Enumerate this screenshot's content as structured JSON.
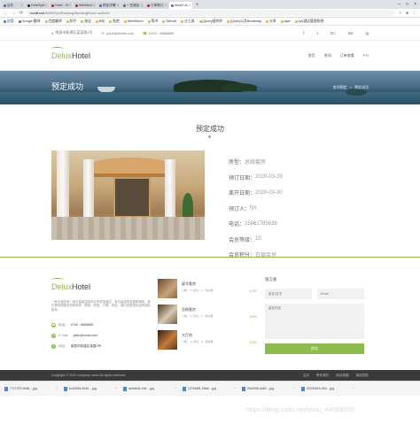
{
  "browser": {
    "tabs": [
      {
        "label": "这件"
      },
      {
        "label": "HotelSystem/s"
      },
      {
        "label": "Hotel - Gitee"
      },
      {
        "label": "WebMusicoptic"
      },
      {
        "label": "预定详情管理"
      },
      {
        "label": "一些酒店"
      },
      {
        "label": "订单预订系统"
      },
      {
        "label": "About Us"
      }
    ],
    "url_host": "localhost",
    "url_path": ":8080/Sys/Booking/BookingRoom.action#",
    "bookmarks": [
      "应用",
      "Google 翻译",
      "百度翻译",
      "知乎",
      "淘宝",
      "B站",
      "贴吧",
      "WebStorm",
      "简书",
      "GitHub",
      "计工具",
      "jQuery插件库",
      "jQuery以及Bootstrap",
      "分享",
      "ajax",
      "sys酒店管理系统"
    ]
  },
  "topbar": {
    "address": "南昌市新建区某某路1号",
    "email": "yuhe@email.com",
    "phone": "0769 - 8888888",
    "social": [
      "f",
      "t",
      "G+",
      "Be",
      "ig"
    ]
  },
  "header": {
    "logo_part1": "Delux",
    "logo_part2": "Hotel",
    "nav": [
      "首页",
      "房间",
      "订单查看",
      "FYI"
    ]
  },
  "banner": {
    "title": "预定成功",
    "crumb_home": "房间预定",
    "crumb_sep": ">",
    "crumb_current": "预定成功"
  },
  "booking": {
    "heading": "预定成功",
    "rows": [
      {
        "key": "房型：",
        "value": "总统套房"
      },
      {
        "key": "预订日期：",
        "value": "2020-03-29"
      },
      {
        "key": "离开日期：",
        "value": "2020-03-30"
      },
      {
        "key": "预订人：",
        "value": "fys"
      },
      {
        "key": "电话：",
        "value": "15861785638"
      },
      {
        "key": "会员等级：",
        "value": "10"
      },
      {
        "key": "会员积分：",
        "value": "白银会员"
      }
    ]
  },
  "footer": {
    "logo_part1": "Delux",
    "logo_part2": "Hotel",
    "description": "一家大酒店有一间五星级温泉设计的宾馆酒店，有五星级的设施和服务。我们提供的服务多种多样，周到、舒适、方便、安全。我们这里是欢迎有朋友前来。",
    "phone_label": "电话：",
    "phone": "0769 - 8888888",
    "email_label": "E-mail：",
    "email": "yifan@email.com",
    "address_label": "地址：",
    "address": "南昌市新建区某路2号",
    "rooms": [
      {
        "name": "豪华套房",
        "meta": "人数：4 | 床位：2 - 热水器",
        "price": "¥ 300"
      },
      {
        "name": "总统套房",
        "meta": "人数：4 | 床位：2 - 热水器",
        "price": "¥ 500"
      },
      {
        "name": "大厅房",
        "meta": "人数：4 | 床位：2 - 热水器",
        "price": "¥ 600"
      }
    ],
    "form_title": "留言板",
    "name_placeholder": "姓名/名字",
    "email_placeholder": "Email",
    "message_placeholder": "留言内容",
    "send_label": "提交"
  },
  "copyright": {
    "text": "Copyright © 2020 company name All rights reserved.",
    "links": [
      "主页",
      "联系我们",
      "网站地图",
      "网站导航"
    ]
  },
  "downloads": [
    {
      "name": "77c7379-40a6 ...jpg"
    },
    {
      "name": "bc2b53a-814e ...jpg"
    },
    {
      "name": "ae9a5d1-44e ...jpg"
    },
    {
      "name": "127bb8f1-28a6 ...jpg"
    },
    {
      "name": "26d3f36-4a53 ...jpg"
    },
    {
      "name": "20230516-40d ...jpg"
    }
  ],
  "watermark": "https://blog.csdn.net/yixiu_44989209"
}
